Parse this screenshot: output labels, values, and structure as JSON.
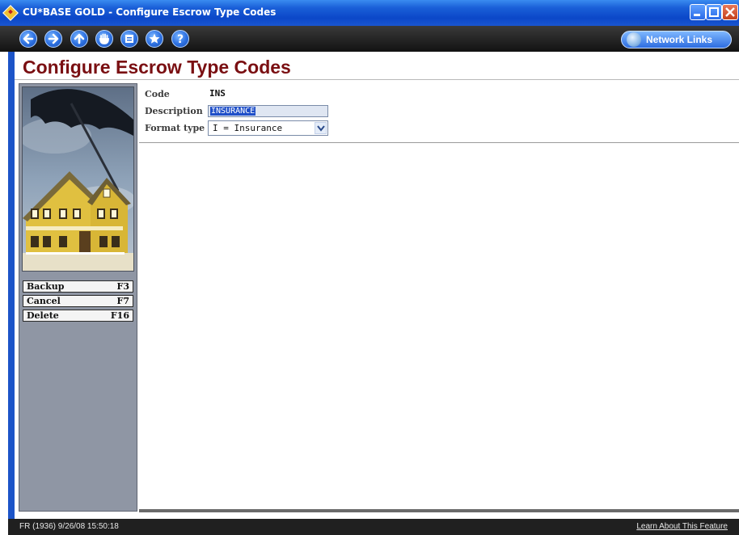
{
  "window": {
    "title": "CU*BASE GOLD - Configure Escrow Type Codes",
    "icon": "app-diamond-icon",
    "controls": [
      "minimize-icon",
      "maximize-icon",
      "close-icon"
    ]
  },
  "toolbar": {
    "nav_buttons": [
      "back-icon",
      "forward-icon",
      "up-icon",
      "hand-icon",
      "print-icon",
      "favorites-star-icon",
      "help-icon"
    ],
    "network_links_label": "Network Links"
  },
  "page": {
    "title": "Configure Escrow Type Codes"
  },
  "form": {
    "code_label": "Code",
    "code_value": "INS",
    "description_label": "Description",
    "description_value": "INSURANCE",
    "format_type_label": "Format type",
    "format_type_value": "I = Insurance"
  },
  "sidebar": {
    "image": "house-umbrella-image",
    "function_keys": [
      {
        "label": "Backup",
        "key": "F3"
      },
      {
        "label": "Cancel",
        "key": "F7"
      },
      {
        "label": "Delete",
        "key": "F16"
      }
    ]
  },
  "status": {
    "left": "FR (1936) 9/26/08 15:50:18",
    "right": "Learn About This Feature"
  },
  "colors": {
    "title_bar": "#0b47c8",
    "page_title": "#7a0f12",
    "sidebar": "#8f96a4",
    "selection": "#1f4fc8"
  }
}
